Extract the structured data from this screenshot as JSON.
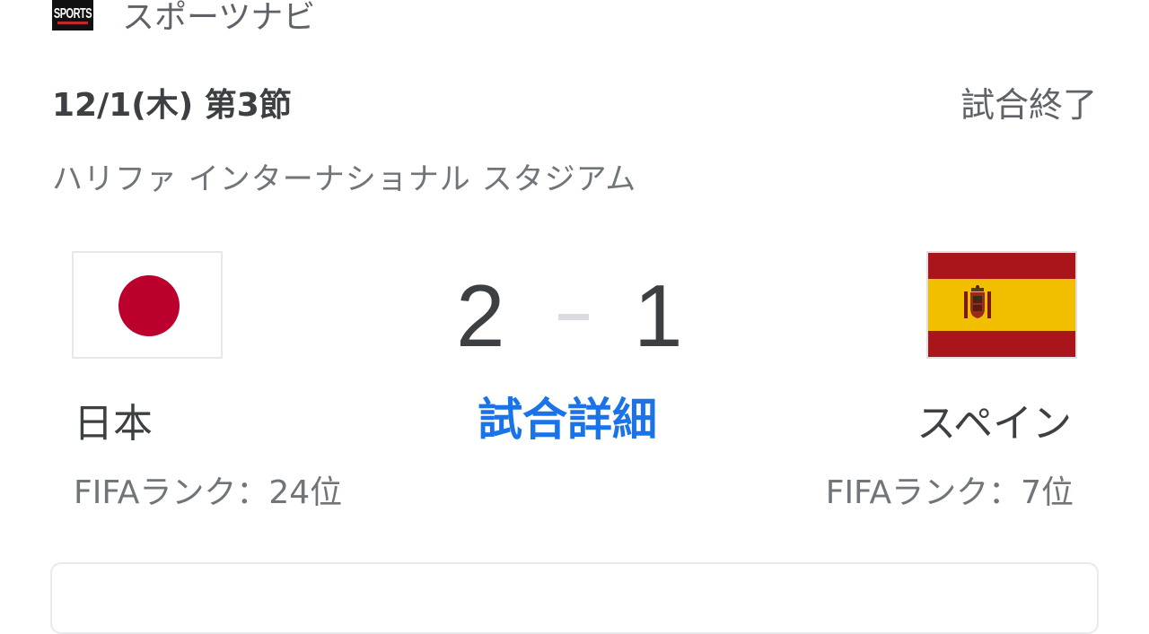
{
  "source": {
    "logo_text": "SPORTS",
    "name": "スポーツナビ"
  },
  "match": {
    "date_round": "12/1(木) 第3節",
    "status": "試合終了",
    "venue": "ハリファ インターナショナル スタジアム",
    "details_link": "試合詳細",
    "score_separator": "-"
  },
  "home": {
    "name": "日本",
    "score": "2",
    "rank": "FIFAランク：24位",
    "flag": "japan-flag-icon"
  },
  "away": {
    "name": "スペイン",
    "score": "1",
    "rank": "FIFAランク：7位",
    "flag": "spain-flag-icon"
  },
  "colors": {
    "link": "#1a73e8",
    "japan_red": "#bc002d",
    "spain_red": "#aa151b",
    "spain_yellow": "#f1bf00"
  }
}
